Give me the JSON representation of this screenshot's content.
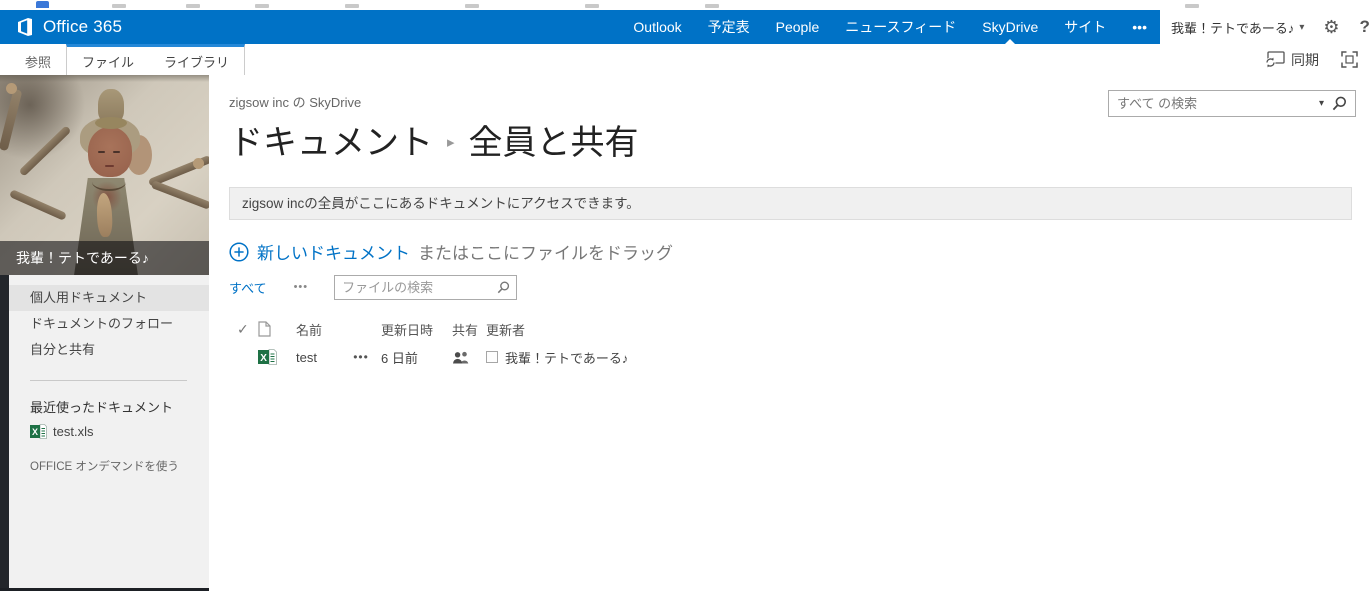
{
  "suite_bar": {
    "brand": "Office 365",
    "nav": [
      {
        "label": "Outlook"
      },
      {
        "label": "予定表"
      },
      {
        "label": "People"
      },
      {
        "label": "ニュースフィード"
      },
      {
        "label": "SkyDrive",
        "current": true
      },
      {
        "label": "サイト"
      },
      {
        "label": "•••"
      }
    ],
    "user_name": "我輩！テトであーる♪",
    "user_caret": "▾",
    "gear_icon": "⚙",
    "help_label": "?"
  },
  "ribbon": {
    "tab_browse": "参照",
    "tab_files": "ファイル",
    "tab_library": "ライブラリ",
    "sync_label": "同期"
  },
  "sidebar": {
    "photo_caption": "我輩！テトであーる♪",
    "nav_items": [
      {
        "label": "個人用ドキュメント",
        "selected": true
      },
      {
        "label": "ドキュメントのフォロー"
      },
      {
        "label": "自分と共有"
      }
    ],
    "recent_header": "最近使ったドキュメント",
    "recent_file": "test.xls",
    "footer_link": "OFFICE オンデマンドを使う"
  },
  "main": {
    "breadcrumb": "zigsow inc の SkyDrive",
    "title_primary": "ドキュメント",
    "title_separator": "▸",
    "title_secondary": "全員と共有",
    "notice": "zigsow incの全員がここにあるドキュメントにアクセスできます。",
    "new_doc_link": "新しいドキュメント",
    "new_doc_suffix": "またはここにファイルをドラッグ",
    "view_current": "すべて",
    "view_more": "•••",
    "file_search_placeholder": "ファイルの検索",
    "scope_search_placeholder": "すべて の検索",
    "scope_search_caret": "▾",
    "table": {
      "select_all_icon": "✓",
      "headers": {
        "name": "名前",
        "modified": "更新日時",
        "sharing": "共有",
        "author": "更新者"
      },
      "rows": [
        {
          "name": "test",
          "menu": "•••",
          "modified": "6 日前",
          "author": "我輩！テトであーる♪"
        }
      ]
    }
  },
  "colors": {
    "suite_bar_blue": "#0072c6",
    "link_blue": "#0072c6",
    "tab_accent_blue": "#2488d8",
    "sidebar_gray": "#f1f1f1",
    "selected_item_gray": "#e3e3e3",
    "excel_green": "#1e7145"
  }
}
